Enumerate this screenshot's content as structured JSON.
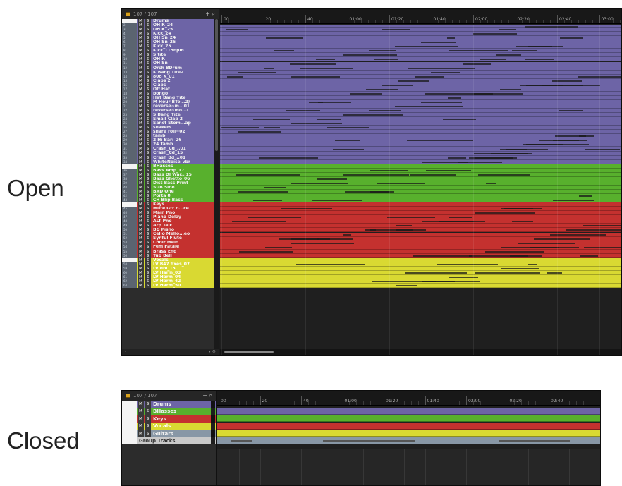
{
  "captions": {
    "open": "Open",
    "closed": "Closed"
  },
  "track_list": {
    "count": "107 / 107",
    "icons": "+ ⌕",
    "footer_left": "‹",
    "footer_right": "▾ ⚙"
  },
  "ruler_labels": [
    "00",
    "20",
    "40",
    "01:00",
    "01:20",
    "01:40",
    "02:00",
    "02:20",
    "02:40",
    "03:00"
  ],
  "colors": {
    "drums": "#6d64a6",
    "basses": "#58b02d",
    "keys": "#c4312f",
    "vocals": "#d9d932",
    "guitars": "#8897a6",
    "group_tracks": "#c9c9c9"
  },
  "mute_label": "M",
  "solo_label": "S",
  "open_tracks": [
    {
      "num": "",
      "name": "Drums",
      "group": "drums",
      "folder": true
    },
    {
      "num": "2",
      "name": "OH K_24",
      "group": "drums"
    },
    {
      "num": "3",
      "name": "OH K_25",
      "group": "drums"
    },
    {
      "num": "4",
      "name": "Kick_24",
      "group": "drums"
    },
    {
      "num": "5",
      "name": "OH Sn_24",
      "group": "drums"
    },
    {
      "num": "6",
      "name": "OH Sn_25",
      "group": "drums"
    },
    {
      "num": "7",
      "name": "Kick_25",
      "group": "drums"
    },
    {
      "num": "8",
      "name": "Kick 115bpm",
      "group": "drums"
    },
    {
      "num": "9",
      "name": "S tite",
      "group": "drums"
    },
    {
      "num": "10",
      "name": "OH K",
      "group": "drums"
    },
    {
      "num": "11",
      "name": "OH Sn",
      "group": "drums"
    },
    {
      "num": "12",
      "name": "Orch BDrum",
      "group": "drums"
    },
    {
      "num": "13",
      "name": "K Bang Tite2",
      "group": "drums"
    },
    {
      "num": "14",
      "name": "808 K_01",
      "group": "drums"
    },
    {
      "num": "15",
      "name": "Claps 2",
      "group": "drums"
    },
    {
      "num": "16",
      "name": "Claps",
      "group": "drums"
    },
    {
      "num": "17",
      "name": "Off Hat",
      "group": "drums"
    },
    {
      "num": "18",
      "name": "bongo",
      "group": "drums"
    },
    {
      "num": "19",
      "name": "Hat Bang Tite",
      "group": "drums"
    },
    {
      "num": "20",
      "name": "M Hour BTo...2)",
      "group": "drums"
    },
    {
      "num": "21",
      "name": "reverse~m...01",
      "group": "drums"
    },
    {
      "num": "22",
      "name": "reverse~mo...L",
      "group": "drums"
    },
    {
      "num": "23",
      "name": "S Bang Tite",
      "group": "drums"
    },
    {
      "num": "24",
      "name": "Small Clap 2",
      "group": "drums"
    },
    {
      "num": "25",
      "name": "Sanct Stom...ap",
      "group": "drums"
    },
    {
      "num": "26",
      "name": "shakers",
      "group": "drums"
    },
    {
      "num": "27",
      "name": "snare roll~02",
      "group": "drums"
    },
    {
      "num": "28",
      "name": "tamb",
      "group": "drums"
    },
    {
      "num": "29",
      "name": "2 Hi Bari_26",
      "group": "drums"
    },
    {
      "num": "30",
      "name": "24 Tamb",
      "group": "drums"
    },
    {
      "num": "31",
      "name": "Crash_Cd_..01",
      "group": "drums"
    },
    {
      "num": "32",
      "name": "Crash_Cd_15",
      "group": "drums"
    },
    {
      "num": "33",
      "name": "Crash Bd_..01",
      "group": "drums"
    },
    {
      "num": "34",
      "name": "WhiteNoise_vbr",
      "group": "drums"
    },
    {
      "num": "",
      "name": "BHasses",
      "group": "basses",
      "folder": true
    },
    {
      "num": "36",
      "name": "Bass Amp_17",
      "group": "basses"
    },
    {
      "num": "37",
      "name": "Bass DI War...15",
      "group": "basses"
    },
    {
      "num": "38",
      "name": "Bass Ghetto_06",
      "group": "basses"
    },
    {
      "num": "39",
      "name": "Dist Bass Print",
      "group": "basses"
    },
    {
      "num": "40",
      "name": "SUB Sine",
      "group": "basses"
    },
    {
      "num": "41",
      "name": "BAD One",
      "group": "basses"
    },
    {
      "num": "42",
      "name": "Porta 8",
      "group": "basses"
    },
    {
      "num": "43",
      "name": "CH Blip Bass",
      "group": "basses"
    },
    {
      "num": "",
      "name": "Keys",
      "group": "keys",
      "folder": true
    },
    {
      "num": "45",
      "name": "Mute Gtr b...ce",
      "group": "keys"
    },
    {
      "num": "46",
      "name": "Main Pno",
      "group": "keys"
    },
    {
      "num": "47",
      "name": "Piano Delay",
      "group": "keys"
    },
    {
      "num": "48",
      "name": "ALT Pno",
      "group": "keys"
    },
    {
      "num": "49",
      "name": "Arp Talk",
      "group": "keys"
    },
    {
      "num": "50",
      "name": "BG Pisno",
      "group": "keys"
    },
    {
      "num": "51",
      "name": "Cello Mello...eo",
      "group": "keys"
    },
    {
      "num": "52",
      "name": "Synful Flute",
      "group": "keys"
    },
    {
      "num": "53",
      "name": "Choir Melo",
      "group": "keys"
    },
    {
      "num": "54",
      "name": "Fem Fatale",
      "group": "keys"
    },
    {
      "num": "55",
      "name": "Brass End",
      "group": "keys"
    },
    {
      "num": "56",
      "name": "Tub Bell",
      "group": "keys"
    },
    {
      "num": "",
      "name": "Vocals",
      "group": "vocals",
      "folder": true
    },
    {
      "num": "58",
      "name": "LV B47 fixes_07",
      "group": "vocals"
    },
    {
      "num": "59",
      "name": "LV dbl_15",
      "group": "vocals"
    },
    {
      "num": "60",
      "name": "LV Harm_03",
      "group": "vocals"
    },
    {
      "num": "61",
      "name": "LV Harm_04",
      "group": "vocals"
    },
    {
      "num": "62",
      "name": "LV Harm_42",
      "group": "vocals"
    },
    {
      "num": "63",
      "name": "LV Harm_50",
      "group": "vocals"
    }
  ],
  "closed_tracks": [
    {
      "name": "Drums",
      "group": "drums"
    },
    {
      "name": "BHasses",
      "group": "basses"
    },
    {
      "name": "Keys",
      "group": "keys"
    },
    {
      "name": "Vocals",
      "group": "vocals"
    },
    {
      "name": "Guitars",
      "group": "guitars"
    },
    {
      "name": "Group Tracks",
      "group": "group_tracks",
      "plain": true
    }
  ]
}
